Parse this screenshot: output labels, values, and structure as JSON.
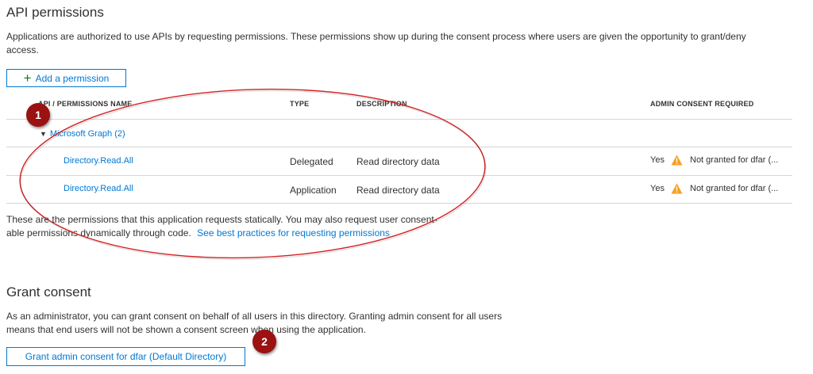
{
  "page": {
    "title": "API permissions",
    "description": "Applications are authorized to use APIs by requesting permissions. These permissions show up during the consent process where users are given the opportunity to grant/deny access."
  },
  "toolbar": {
    "add_permission_label": "Add a permission",
    "add_icon": "plus-icon"
  },
  "table": {
    "headers": {
      "name": "API / PERMISSIONS NAME",
      "type": "TYPE",
      "description": "DESCRIPTION",
      "admin_consent": "ADMIN CONSENT REQUIRED"
    },
    "group": {
      "label": "Microsoft Graph (2)",
      "expanded": true
    },
    "rows": [
      {
        "name": "Directory.Read.All",
        "type": "Delegated",
        "description": "Read directory data",
        "admin_consent": "Yes",
        "status": "Not granted for dfar (..."
      },
      {
        "name": "Directory.Read.All",
        "type": "Application",
        "description": "Read directory data",
        "admin_consent": "Yes",
        "status": "Not granted for dfar (..."
      }
    ],
    "footer_line1": "These are the permissions that this application requests statically. You may also request user consent-",
    "footer_line2": "able permissions dynamically through code.",
    "footer_link": "See best practices for requesting permissions"
  },
  "grant": {
    "title": "Grant consent",
    "line1": "As an administrator, you can grant consent on behalf of all users in this directory. Granting admin consent for all users",
    "line2": "means that end users will not be shown a consent screen when using the application.",
    "button_label": "Grant admin consent for dfar (Default Directory)"
  },
  "annotations": {
    "badge1": "1",
    "badge2": "2"
  },
  "colors": {
    "accent": "#0078d4",
    "warning": "#f7a022",
    "annotation": "#d42020",
    "badge": "#9a1212"
  }
}
